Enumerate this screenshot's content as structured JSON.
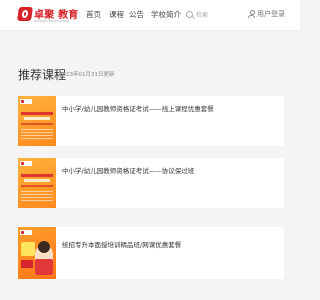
{
  "header": {
    "logo": {
      "brand": "卓聚 教育",
      "sub": "ZHUOJU EDUCATION"
    },
    "nav": [
      {
        "label": "首页"
      },
      {
        "label": "课程"
      },
      {
        "label": "公告"
      },
      {
        "label": "学校简介"
      }
    ],
    "search": {
      "label": "检索",
      "icon": "search-icon"
    },
    "login": {
      "label": "用户登录",
      "icon": "user-icon"
    }
  },
  "section": {
    "title": "推荐课程",
    "updated": "2023年01月31日更新"
  },
  "courses": [
    {
      "title": "中小学/幼儿园教师资格证考试——线上课程优惠套餐"
    },
    {
      "title": "中小学/幼儿园教师资格证考试——协议保过班"
    },
    {
      "title": "统招专升本面授培训精品班/网课优惠套餐"
    }
  ],
  "colors": {
    "brand_red": "#d8232a",
    "thumb_orange": "#ff8a1e",
    "background": "#f4f4f4"
  }
}
